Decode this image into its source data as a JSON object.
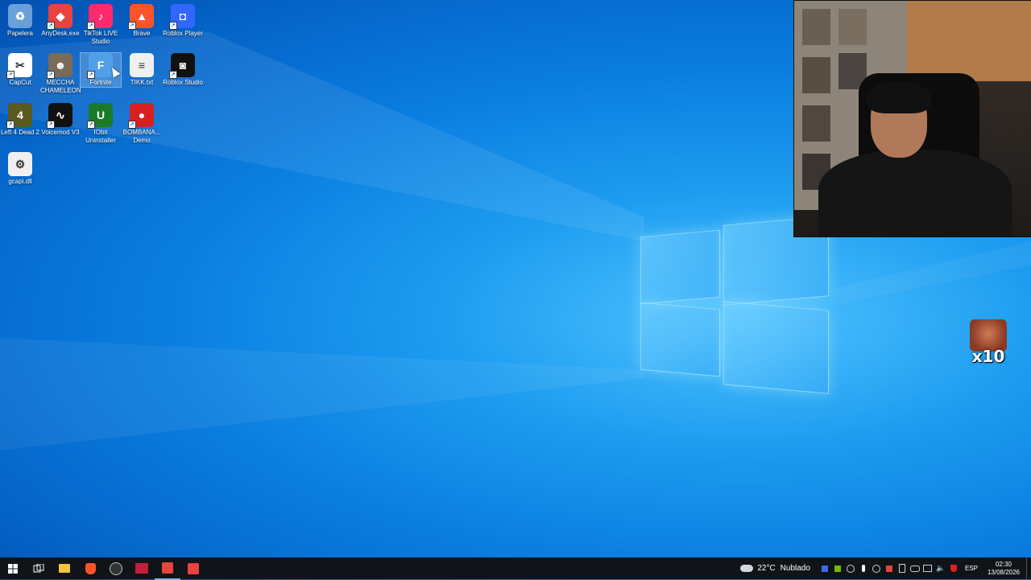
{
  "desktop": {
    "icons": [
      {
        "label": "Papelera",
        "icon": "recycle-bin-icon",
        "color": "#6aa0d8"
      },
      {
        "label": "AnyDesk.exe",
        "icon": "anydesk-icon",
        "color": "#e8433d"
      },
      {
        "label": "TikTok LIVE Studio",
        "icon": "tiktok-icon",
        "color": "#ff2a6d"
      },
      {
        "label": "Brave",
        "icon": "brave-icon",
        "color": "#fb542b"
      },
      {
        "label": "Roblox Player",
        "icon": "roblox-icon",
        "color": "#3366ff"
      },
      {
        "label": "CapCut",
        "icon": "capcut-icon",
        "color": "#ffffff"
      },
      {
        "label": "MECCHA CHAMELEON",
        "icon": "game-icon",
        "color": "#7a6a5a"
      },
      {
        "label": "Fortnite",
        "icon": "fortnite-icon",
        "color": "#4fa0e8"
      },
      {
        "label": "TIKK.txt",
        "icon": "text-file-icon",
        "color": "#f0f0f0"
      },
      {
        "label": "Roblox Studio",
        "icon": "roblox-studio-icon",
        "color": "#111111"
      },
      {
        "label": "Left 4 Dead 2",
        "icon": "l4d2-icon",
        "color": "#5a5a20"
      },
      {
        "label": "Voicemod V3",
        "icon": "voicemod-icon",
        "color": "#111111"
      },
      {
        "label": "IObit Uninstaller",
        "icon": "iobit-icon",
        "color": "#1a7a2a"
      },
      {
        "label": "BOMBANA... Demo",
        "icon": "bombana-icon",
        "color": "#d82020"
      },
      {
        "label": "gcapi.dll",
        "icon": "dll-file-icon",
        "color": "#f0f0f0"
      }
    ]
  },
  "overlay": {
    "multiplier": "x10"
  },
  "taskbar": {
    "apps": [
      "start-icon",
      "task-view-icon",
      "file-explorer-icon",
      "brave-icon",
      "obs-icon",
      "voicemod-icon",
      "anydesk-icon",
      "anydesk-icon"
    ],
    "weather": {
      "temp": "22°C",
      "condition": "Nublado"
    },
    "language": "ESP",
    "time": "02:30",
    "date": "13/08/2026"
  }
}
